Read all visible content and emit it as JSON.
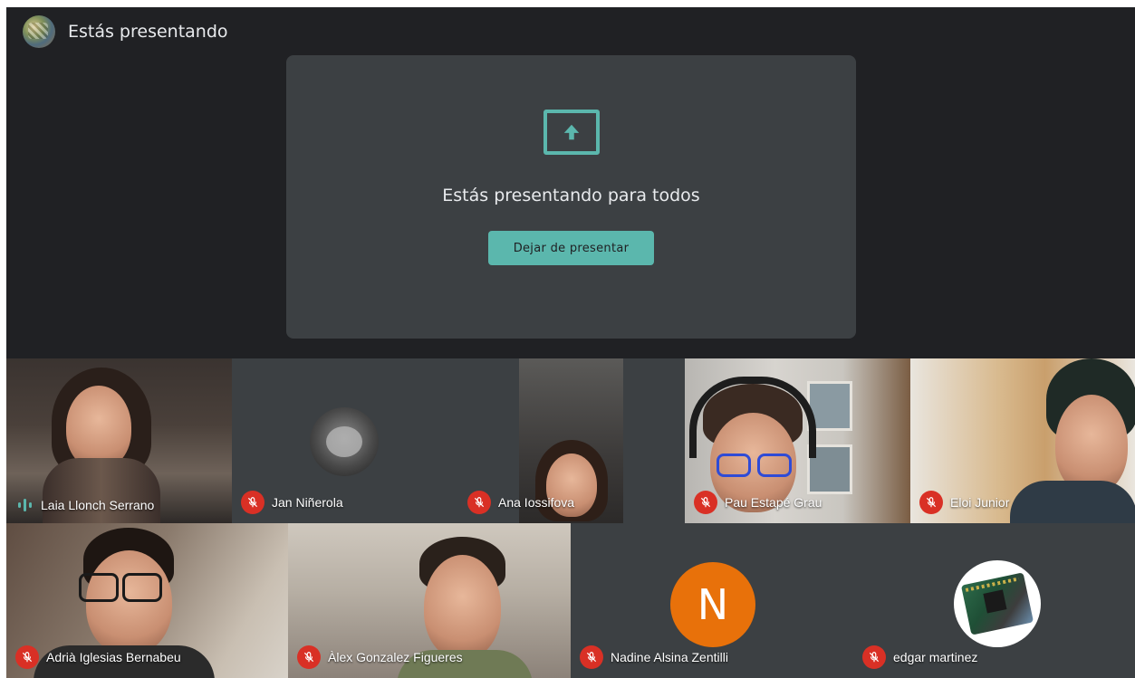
{
  "header": {
    "title": "Estás presentando",
    "avatar_icon": "presenter-avatar"
  },
  "presentation": {
    "icon": "present-to-all-icon",
    "message": "Estás presentando para todos",
    "stop_label": "Dejar de presentar",
    "accent_color": "#5bb7ad"
  },
  "participants": [
    {
      "name": "Laia Llonch Serrano",
      "status": "speaking"
    },
    {
      "name": "Jan Niñerola",
      "status": "muted"
    },
    {
      "name": "Ana Iossifova",
      "status": "muted"
    },
    {
      "name": "Pau Estapé Grau",
      "status": "muted"
    },
    {
      "name": "Eloi Junior",
      "status": "muted"
    },
    {
      "name": "Adrià Iglesias Bernabeu",
      "status": "muted"
    },
    {
      "name": "Àlex Gonzalez Figueres",
      "status": "muted"
    },
    {
      "name": "Nadine Alsina Zentilli",
      "status": "muted",
      "avatar_letter": "N",
      "avatar_color": "#e8710a"
    },
    {
      "name": "edgar martinez",
      "status": "muted"
    }
  ],
  "colors": {
    "background": "#202124",
    "card": "#3c4043",
    "muted_red": "#d93025"
  }
}
